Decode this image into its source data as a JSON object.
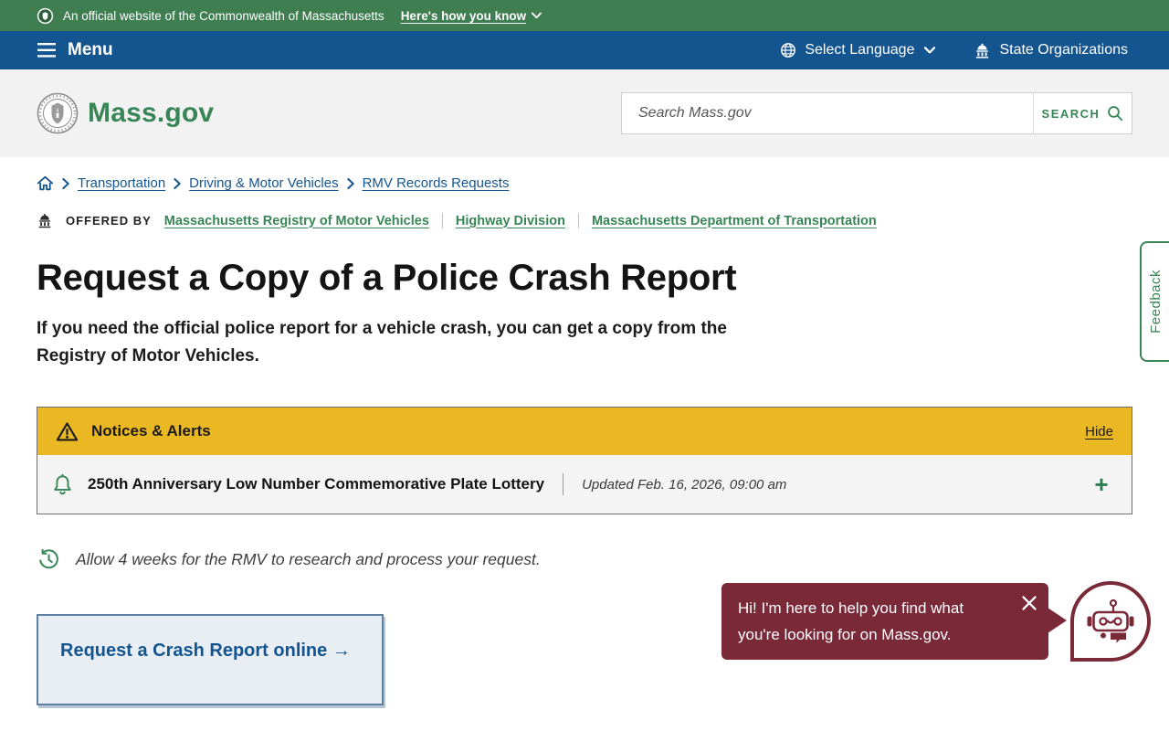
{
  "official_banner": {
    "text": "An official website of the Commonwealth of Massachusetts",
    "link": "Here's how you know"
  },
  "nav": {
    "menu": "Menu",
    "language": "Select Language",
    "state_orgs": "State Organizations"
  },
  "header": {
    "logo": "Mass.gov",
    "search_placeholder": "Search Mass.gov",
    "search_button": "SEARCH"
  },
  "breadcrumb": {
    "items": [
      "Transportation",
      "Driving & Motor Vehicles",
      "RMV Records Requests"
    ]
  },
  "offered_by": {
    "label": "OFFERED BY",
    "agencies": [
      "Massachusetts Registry of Motor Vehicles",
      "Highway Division",
      "Massachusetts Department of Transportation"
    ]
  },
  "page": {
    "title": "Request a Copy of a Police Crash Report",
    "lead": "If you need the official police report for a vehicle crash, you can get a copy from the Registry of Motor Vehicles."
  },
  "notices": {
    "title": "Notices & Alerts",
    "hide": "Hide",
    "alert_title": "250th Anniversary Low Number Commemorative Plate Lottery",
    "alert_updated": "Updated Feb. 16, 2026, 09:00 am",
    "expand": "+"
  },
  "processing_note": "Allow 4 weeks for the RMV to research and process your request.",
  "cta": {
    "label": "Request a Crash Report online",
    "arrow": "→"
  },
  "chatbot": {
    "message": "Hi! I'm here to help you find what you're looking for on Mass.gov."
  },
  "feedback_tab": "Feedback",
  "colors": {
    "banner_green": "#3e7e51",
    "nav_blue": "#14558f",
    "brand_green": "#388557",
    "link_blue": "#14558f",
    "alert_yellow": "#eab822",
    "chatbot_maroon": "#7a2939"
  }
}
